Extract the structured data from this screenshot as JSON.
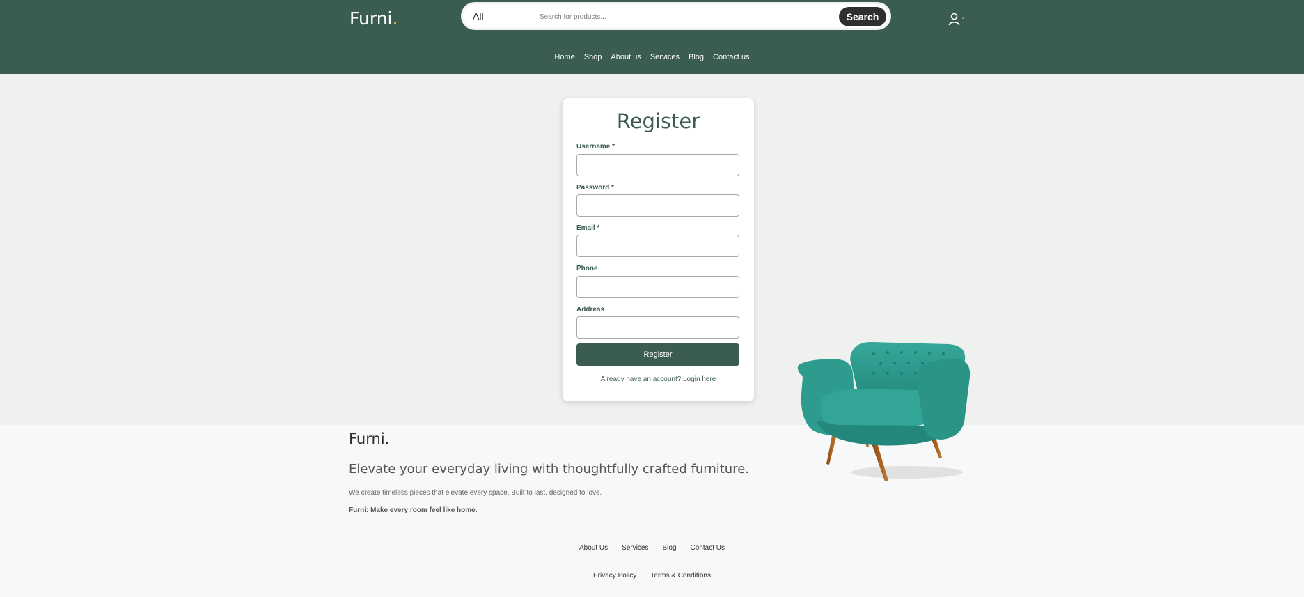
{
  "header": {
    "logo_text": "Furni",
    "logo_dot": ".",
    "search": {
      "category": "All",
      "placeholder": "Search for products...",
      "button_label": "Search"
    },
    "user_caret": "-",
    "nav": [
      "Home",
      "Shop",
      "About us",
      "Services",
      "Blog",
      "Contact us"
    ]
  },
  "register": {
    "title": "Register",
    "fields": [
      {
        "label": "Username *",
        "value": ""
      },
      {
        "label": "Password *",
        "value": ""
      },
      {
        "label": "Email *",
        "value": ""
      },
      {
        "label": "Phone",
        "value": ""
      },
      {
        "label": "Address",
        "value": ""
      }
    ],
    "submit_label": "Register",
    "login_prompt": "Already have an account? Login here"
  },
  "footer": {
    "logo": "Furni.",
    "tagline": "Elevate your everyday living with thoughtfully crafted furniture.",
    "description": "We create timeless pieces that elevate every space. Built to last, designed to love.",
    "motto": "Furni: Make every room feel like home.",
    "links_primary": [
      "About Us",
      "Services",
      "Blog",
      "Contact Us"
    ],
    "links_secondary": [
      "Privacy Policy",
      "Terms & Conditions"
    ]
  },
  "colors": {
    "brand_green": "#3b5d50",
    "accent_yellow": "#f9bf29",
    "chair_teal": "#2d9b8e"
  }
}
